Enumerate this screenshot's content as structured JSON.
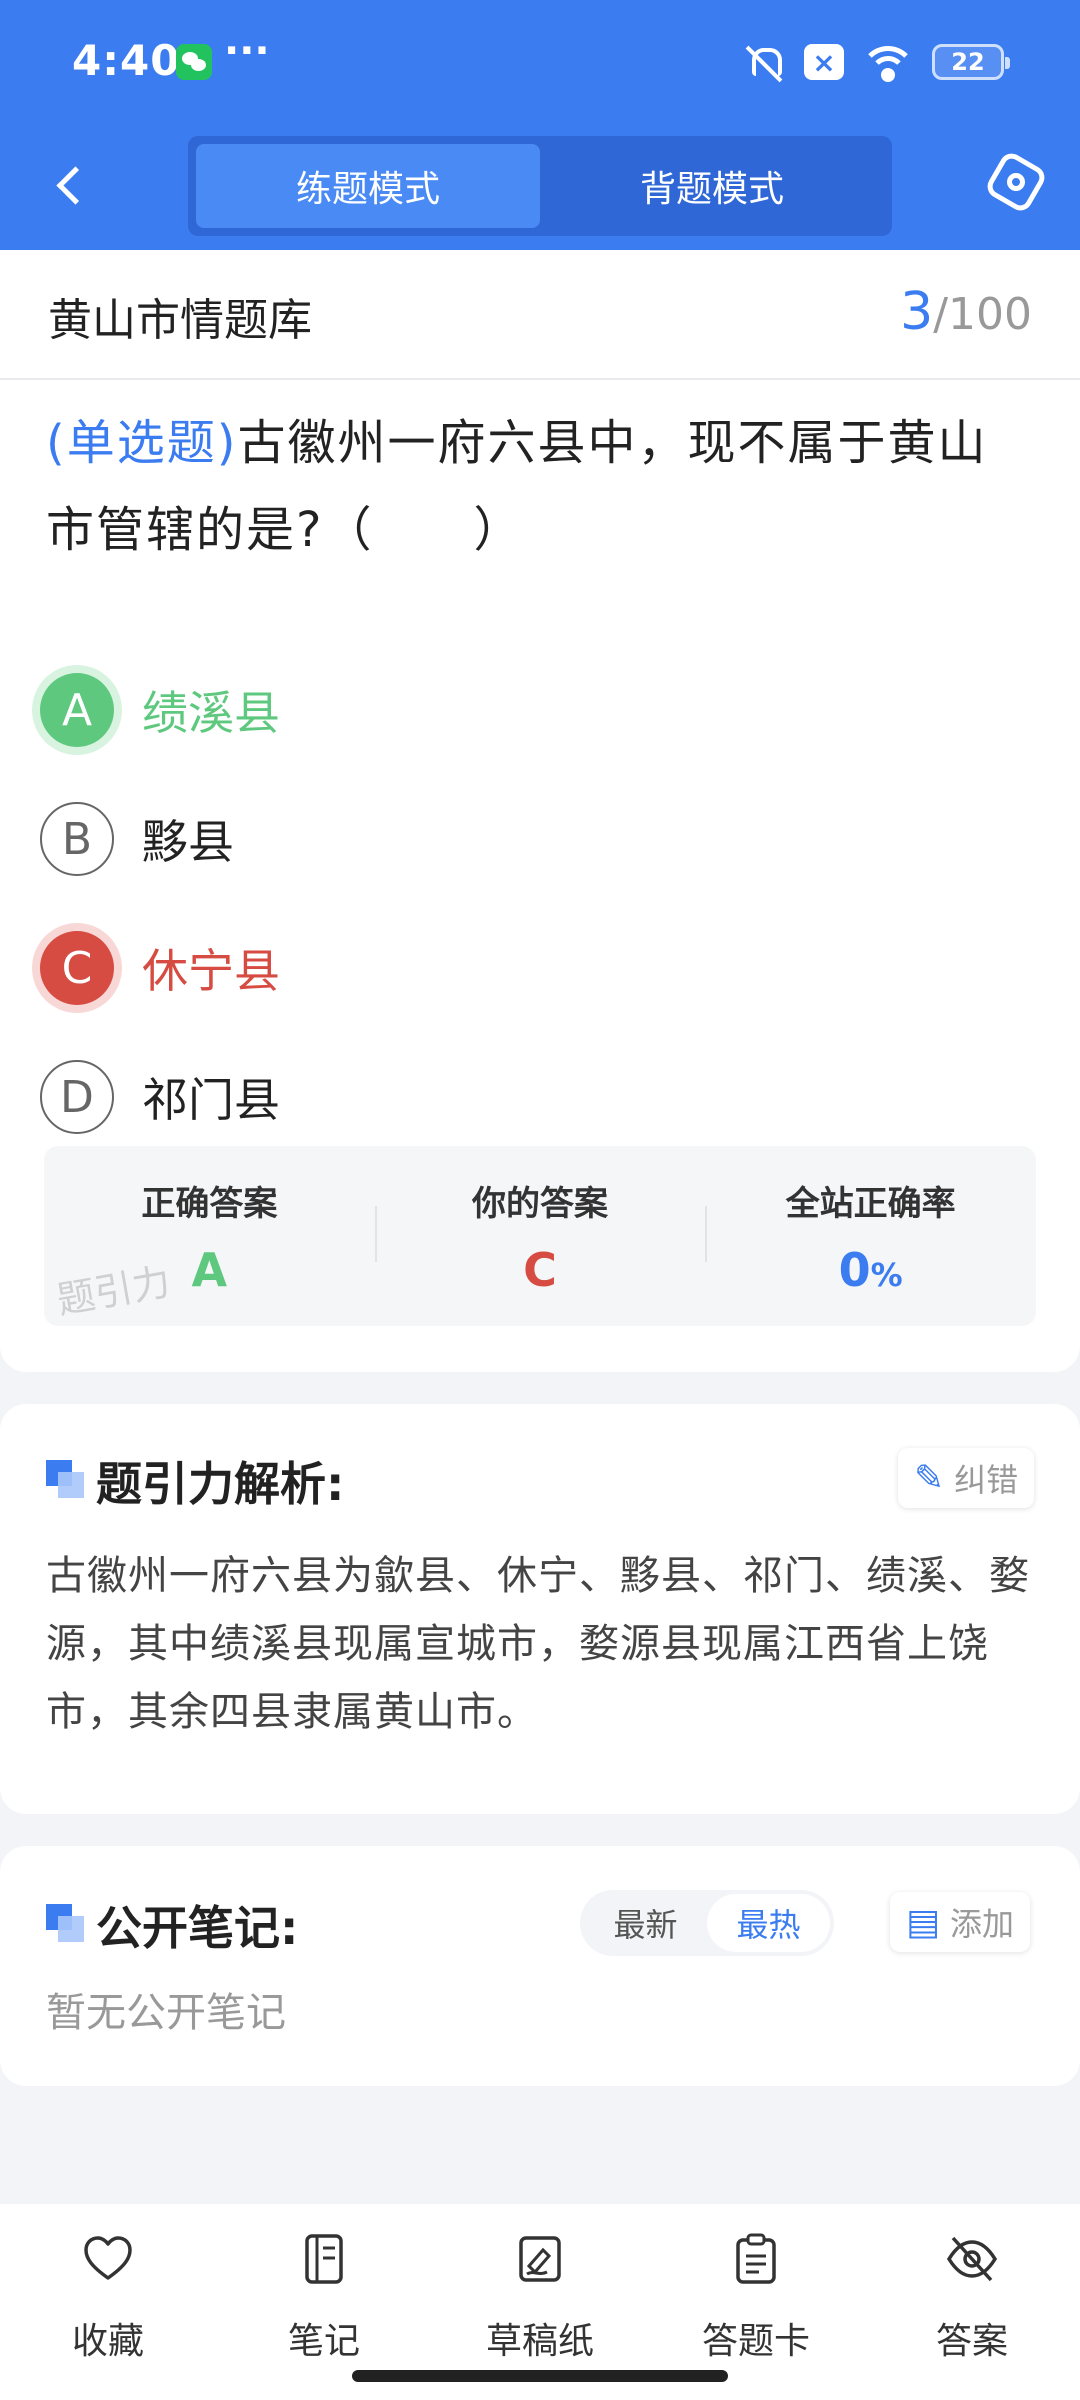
{
  "status_bar": {
    "time": "4:40",
    "more": "···",
    "battery": "22"
  },
  "header": {
    "modes": [
      "练题模式",
      "背题模式"
    ],
    "active_mode": "练题模式"
  },
  "question_bank": {
    "title": "黄山市情题库",
    "current": "3",
    "total": "/100"
  },
  "question": {
    "type": "(单选题)",
    "text": "古徽州一府六县中，现不属于黄山市管辖的是?（　　）"
  },
  "options": [
    {
      "key": "A",
      "text": "绩溪县",
      "state": "correct"
    },
    {
      "key": "B",
      "text": "黟县",
      "state": "normal"
    },
    {
      "key": "C",
      "text": "休宁县",
      "state": "wrong"
    },
    {
      "key": "D",
      "text": "祁门县",
      "state": "normal"
    }
  ],
  "answer_panel": {
    "correct_label": "正确答案",
    "correct_value": "A",
    "yours_label": "你的答案",
    "yours_value": "C",
    "rate_label": "全站正确率",
    "rate_value": "0",
    "rate_unit": "%",
    "watermark": "题引力"
  },
  "analysis": {
    "title": "题引力解析:",
    "report_button": "纠错",
    "text": "古徽州一府六县为歙县、休宁、黟县、祁门、绩溪、婺源，其中绩溪县现属宣城市，婺源县现属江西省上饶市，其余四县隶属黄山市。"
  },
  "notes": {
    "title": "公开笔记:",
    "sort_options": [
      "最新",
      "最热"
    ],
    "active_sort": "最热",
    "add_button": "添加",
    "empty_text": "暂无公开笔记"
  },
  "bottom_bar": {
    "items": [
      {
        "label": "收藏",
        "icon": "heart-icon"
      },
      {
        "label": "笔记",
        "icon": "notebook-icon"
      },
      {
        "label": "草稿纸",
        "icon": "draft-icon"
      },
      {
        "label": "答题卡",
        "icon": "clipboard-icon"
      },
      {
        "label": "答案",
        "icon": "eye-off-icon"
      }
    ]
  },
  "colors": {
    "primary": "#3b7cf0",
    "correct": "#5ec97e",
    "wrong": "#d64b42"
  }
}
